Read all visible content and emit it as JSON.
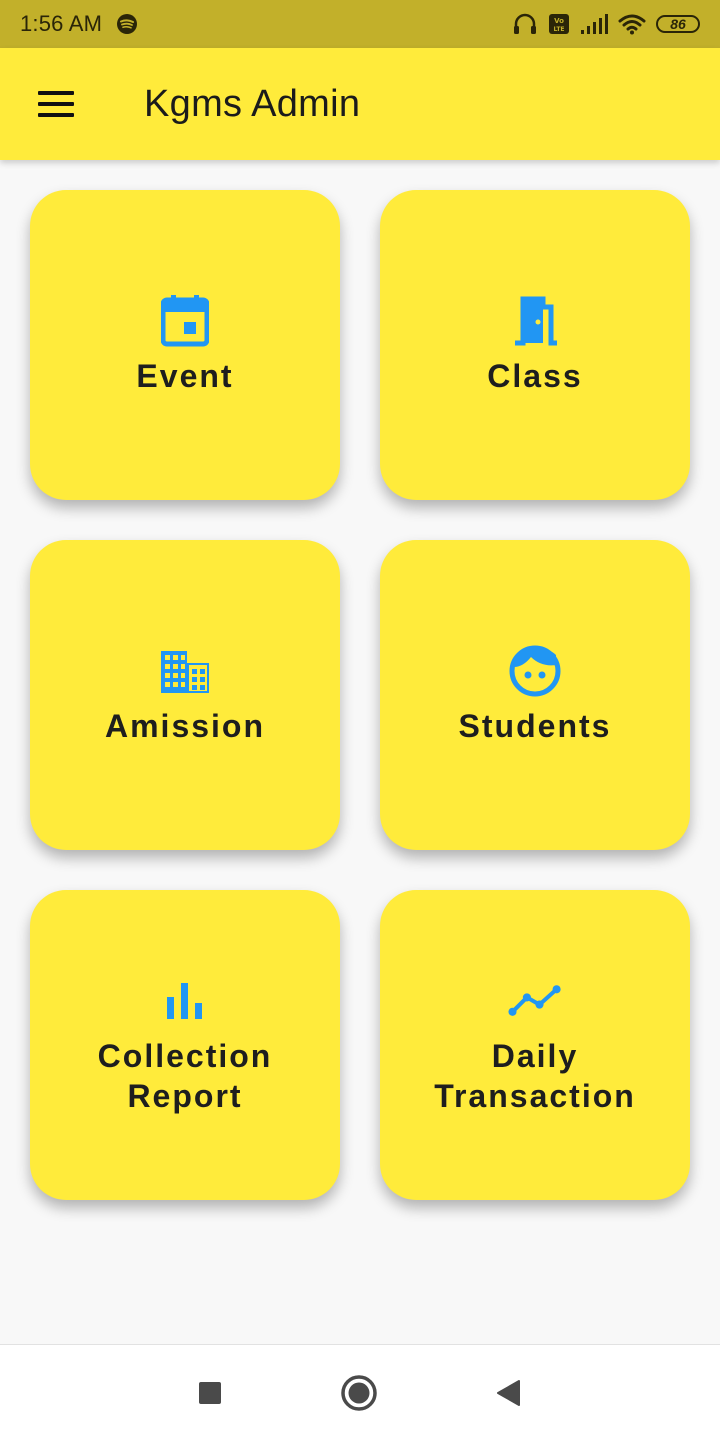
{
  "status_bar": {
    "time": "1:56 AM",
    "battery": "86",
    "icons": [
      "spotify-icon",
      "headphones-icon",
      "volte-icon",
      "signal-icon",
      "wifi-icon",
      "battery-icon"
    ]
  },
  "app_bar": {
    "title": "Kgms Admin",
    "menu_icon": "menu-icon"
  },
  "tiles": [
    {
      "label": "Event",
      "icon": "calendar-icon"
    },
    {
      "label": "Class",
      "icon": "door-icon"
    },
    {
      "label": "Amission",
      "icon": "building-icon"
    },
    {
      "label": "Students",
      "icon": "face-icon"
    },
    {
      "label": "Collection\nReport",
      "icon": "bar-chart-icon"
    },
    {
      "label": "Daily\nTransaction",
      "icon": "line-chart-icon"
    }
  ],
  "nav_bar": {
    "icons": [
      "recents-square-icon",
      "home-circle-icon",
      "back-triangle-icon"
    ]
  },
  "colors": {
    "status_bar": "#c2b02a",
    "app_bar": "#ffeb3b",
    "tile": "#ffeb3b",
    "icon_accent": "#2196f3",
    "background": "#f8f8f8"
  }
}
